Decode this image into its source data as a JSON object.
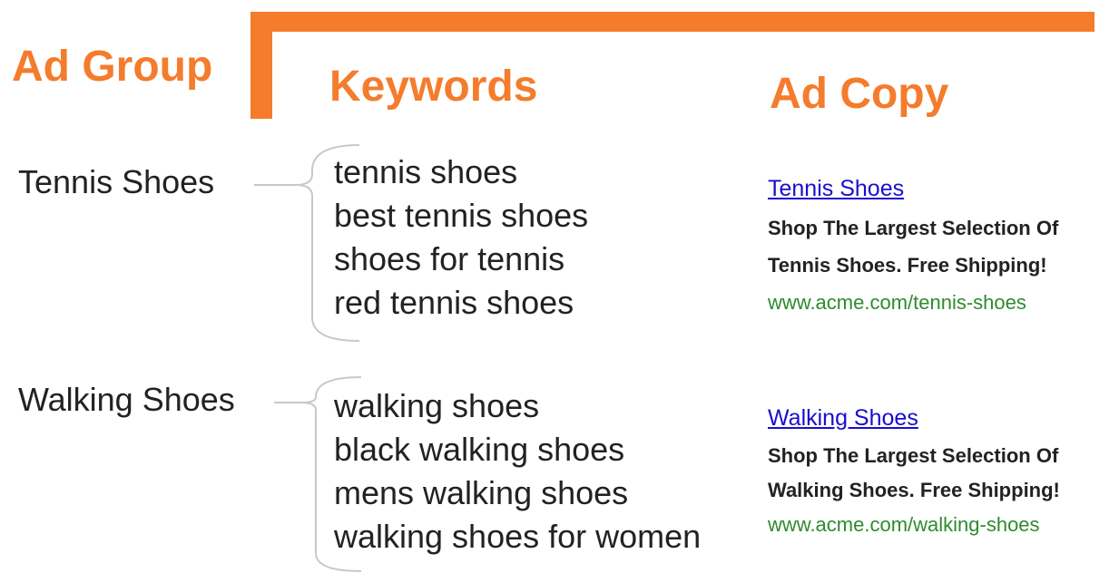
{
  "headers": {
    "ad_group": "Ad Group",
    "keywords": "Keywords",
    "ad_copy": "Ad Copy"
  },
  "colors": {
    "accent": "#f47c2c",
    "ad_title": "#1a0dcc",
    "ad_url": "#2e8b2e",
    "text": "#222222"
  },
  "groups": [
    {
      "name": "Tennis Shoes",
      "keywords": [
        "tennis shoes",
        "best tennis shoes",
        "shoes for tennis",
        "red tennis shoes"
      ],
      "ad": {
        "title": "Tennis Shoes",
        "line1": "Shop The Largest Selection Of",
        "line2": "Tennis Shoes. Free Shipping!",
        "url": "www.acme.com/tennis-shoes"
      }
    },
    {
      "name": "Walking Shoes",
      "keywords": [
        "walking shoes",
        "black walking shoes",
        "mens walking shoes",
        "walking shoes for women"
      ],
      "ad": {
        "title": "Walking Shoes",
        "line1": "Shop The Largest Selection Of",
        "line2": "Walking Shoes. Free Shipping!",
        "url": "www.acme.com/walking-shoes"
      }
    }
  ]
}
